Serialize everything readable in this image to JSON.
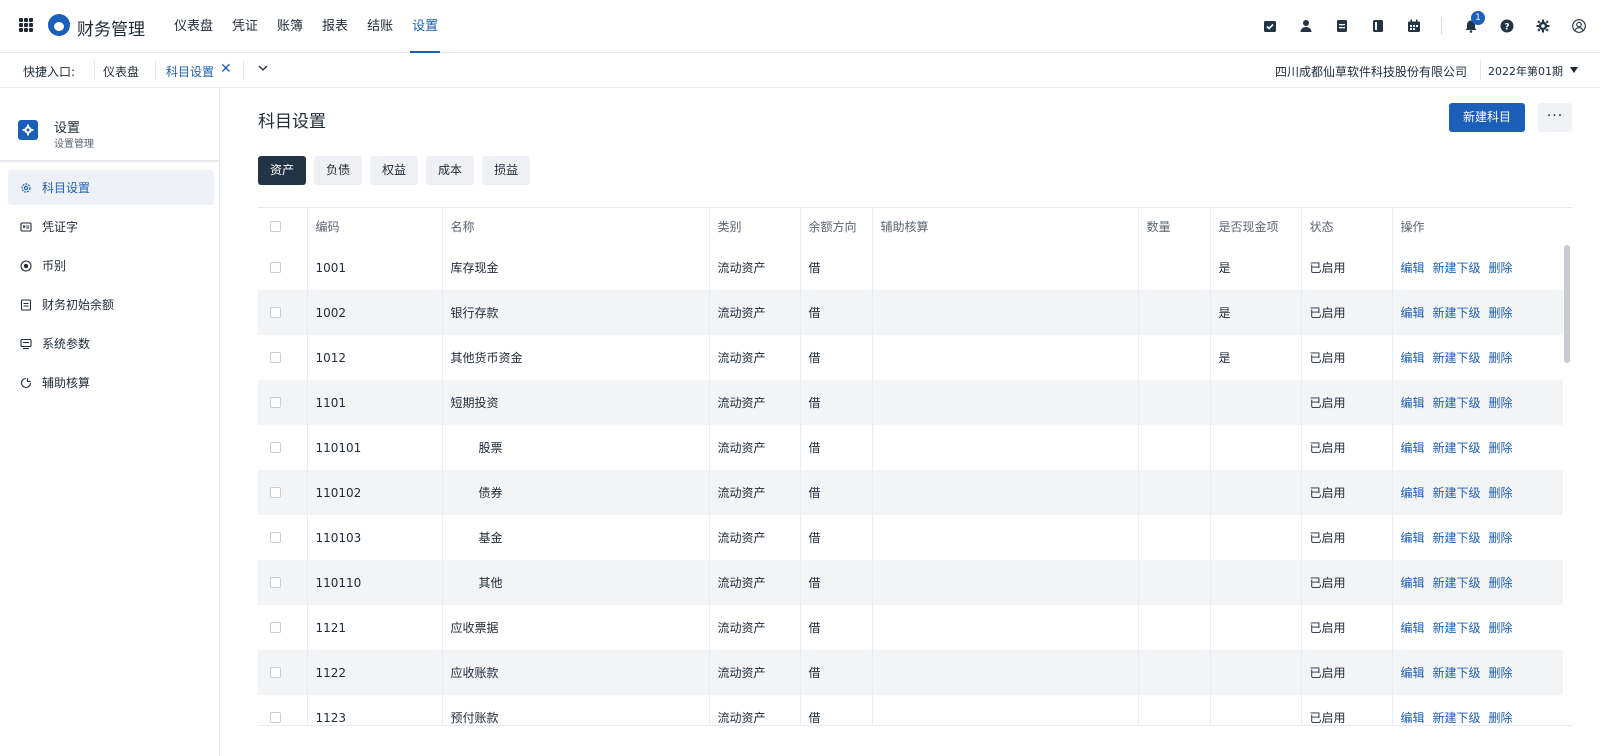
{
  "app": {
    "title": "财务管理"
  },
  "nav": [
    {
      "label": "仪表盘",
      "active": false
    },
    {
      "label": "凭证",
      "active": false
    },
    {
      "label": "账簿",
      "active": false
    },
    {
      "label": "报表",
      "active": false
    },
    {
      "label": "结账",
      "active": false
    },
    {
      "label": "设置",
      "active": true
    }
  ],
  "top_icons": [
    "task-check-icon",
    "user-icon",
    "document-icon",
    "book-icon",
    "calendar-icon",
    "notification-bell-icon",
    "help-icon",
    "settings-gear-icon",
    "user-avatar-icon"
  ],
  "notification_count": "1",
  "quickbar": {
    "label": "快捷入口:",
    "tabs": [
      "仪表盘",
      "科目设置"
    ],
    "close": "✕",
    "company": "四川成都仙草软件科技股份有限公司",
    "period": "2022年第01期"
  },
  "sidebar": {
    "title": "设置",
    "subtitle": "设置管理",
    "items": [
      {
        "label": "科目设置",
        "icon": "gear-icon",
        "active": true
      },
      {
        "label": "凭证字",
        "icon": "id-card-icon",
        "active": false
      },
      {
        "label": "币别",
        "icon": "coin-icon",
        "active": false
      },
      {
        "label": "财务初始余额",
        "icon": "ledger-icon",
        "active": false
      },
      {
        "label": "系统参数",
        "icon": "monitor-icon",
        "active": false
      },
      {
        "label": "辅助核算",
        "icon": "pie-chart-icon",
        "active": false
      }
    ]
  },
  "main": {
    "title": "科目设置",
    "new_button": "新建科目",
    "more_button": "···",
    "category_tabs": [
      "资产",
      "负债",
      "权益",
      "成本",
      "损益"
    ],
    "active_tab": 0
  },
  "table": {
    "columns": [
      "",
      "编码",
      "名称",
      "类别",
      "余额方向",
      "辅助核算",
      "数量",
      "是否现金项",
      "状态",
      "操作"
    ],
    "actions": [
      "编辑",
      "新建下级",
      "删除"
    ],
    "rows": [
      {
        "code": "1001",
        "name": "库存现金",
        "type": "流动资产",
        "direction": "借",
        "aux": "",
        "qty": "",
        "cash": "是",
        "status": "已启用",
        "indent": false
      },
      {
        "code": "1002",
        "name": "银行存款",
        "type": "流动资产",
        "direction": "借",
        "aux": "",
        "qty": "",
        "cash": "是",
        "status": "已启用",
        "indent": false
      },
      {
        "code": "1012",
        "name": "其他货币资金",
        "type": "流动资产",
        "direction": "借",
        "aux": "",
        "qty": "",
        "cash": "是",
        "status": "已启用",
        "indent": false
      },
      {
        "code": "1101",
        "name": "短期投资",
        "type": "流动资产",
        "direction": "借",
        "aux": "",
        "qty": "",
        "cash": "",
        "status": "已启用",
        "indent": false
      },
      {
        "code": "110101",
        "name": "股票",
        "type": "流动资产",
        "direction": "借",
        "aux": "",
        "qty": "",
        "cash": "",
        "status": "已启用",
        "indent": true
      },
      {
        "code": "110102",
        "name": "债券",
        "type": "流动资产",
        "direction": "借",
        "aux": "",
        "qty": "",
        "cash": "",
        "status": "已启用",
        "indent": true
      },
      {
        "code": "110103",
        "name": "基金",
        "type": "流动资产",
        "direction": "借",
        "aux": "",
        "qty": "",
        "cash": "",
        "status": "已启用",
        "indent": true
      },
      {
        "code": "110110",
        "name": "其他",
        "type": "流动资产",
        "direction": "借",
        "aux": "",
        "qty": "",
        "cash": "",
        "status": "已启用",
        "indent": true
      },
      {
        "code": "1121",
        "name": "应收票据",
        "type": "流动资产",
        "direction": "借",
        "aux": "",
        "qty": "",
        "cash": "",
        "status": "已启用",
        "indent": false
      },
      {
        "code": "1122",
        "name": "应收账款",
        "type": "流动资产",
        "direction": "借",
        "aux": "",
        "qty": "",
        "cash": "",
        "status": "已启用",
        "indent": false
      },
      {
        "code": "1123",
        "name": "预付账款",
        "type": "流动资产",
        "direction": "借",
        "aux": "",
        "qty": "",
        "cash": "",
        "status": "已启用",
        "indent": false
      }
    ]
  },
  "colors": {
    "accent": "#1c5fb8",
    "dark_tab": "#243447",
    "row_stripe": "#f3f4f6"
  }
}
